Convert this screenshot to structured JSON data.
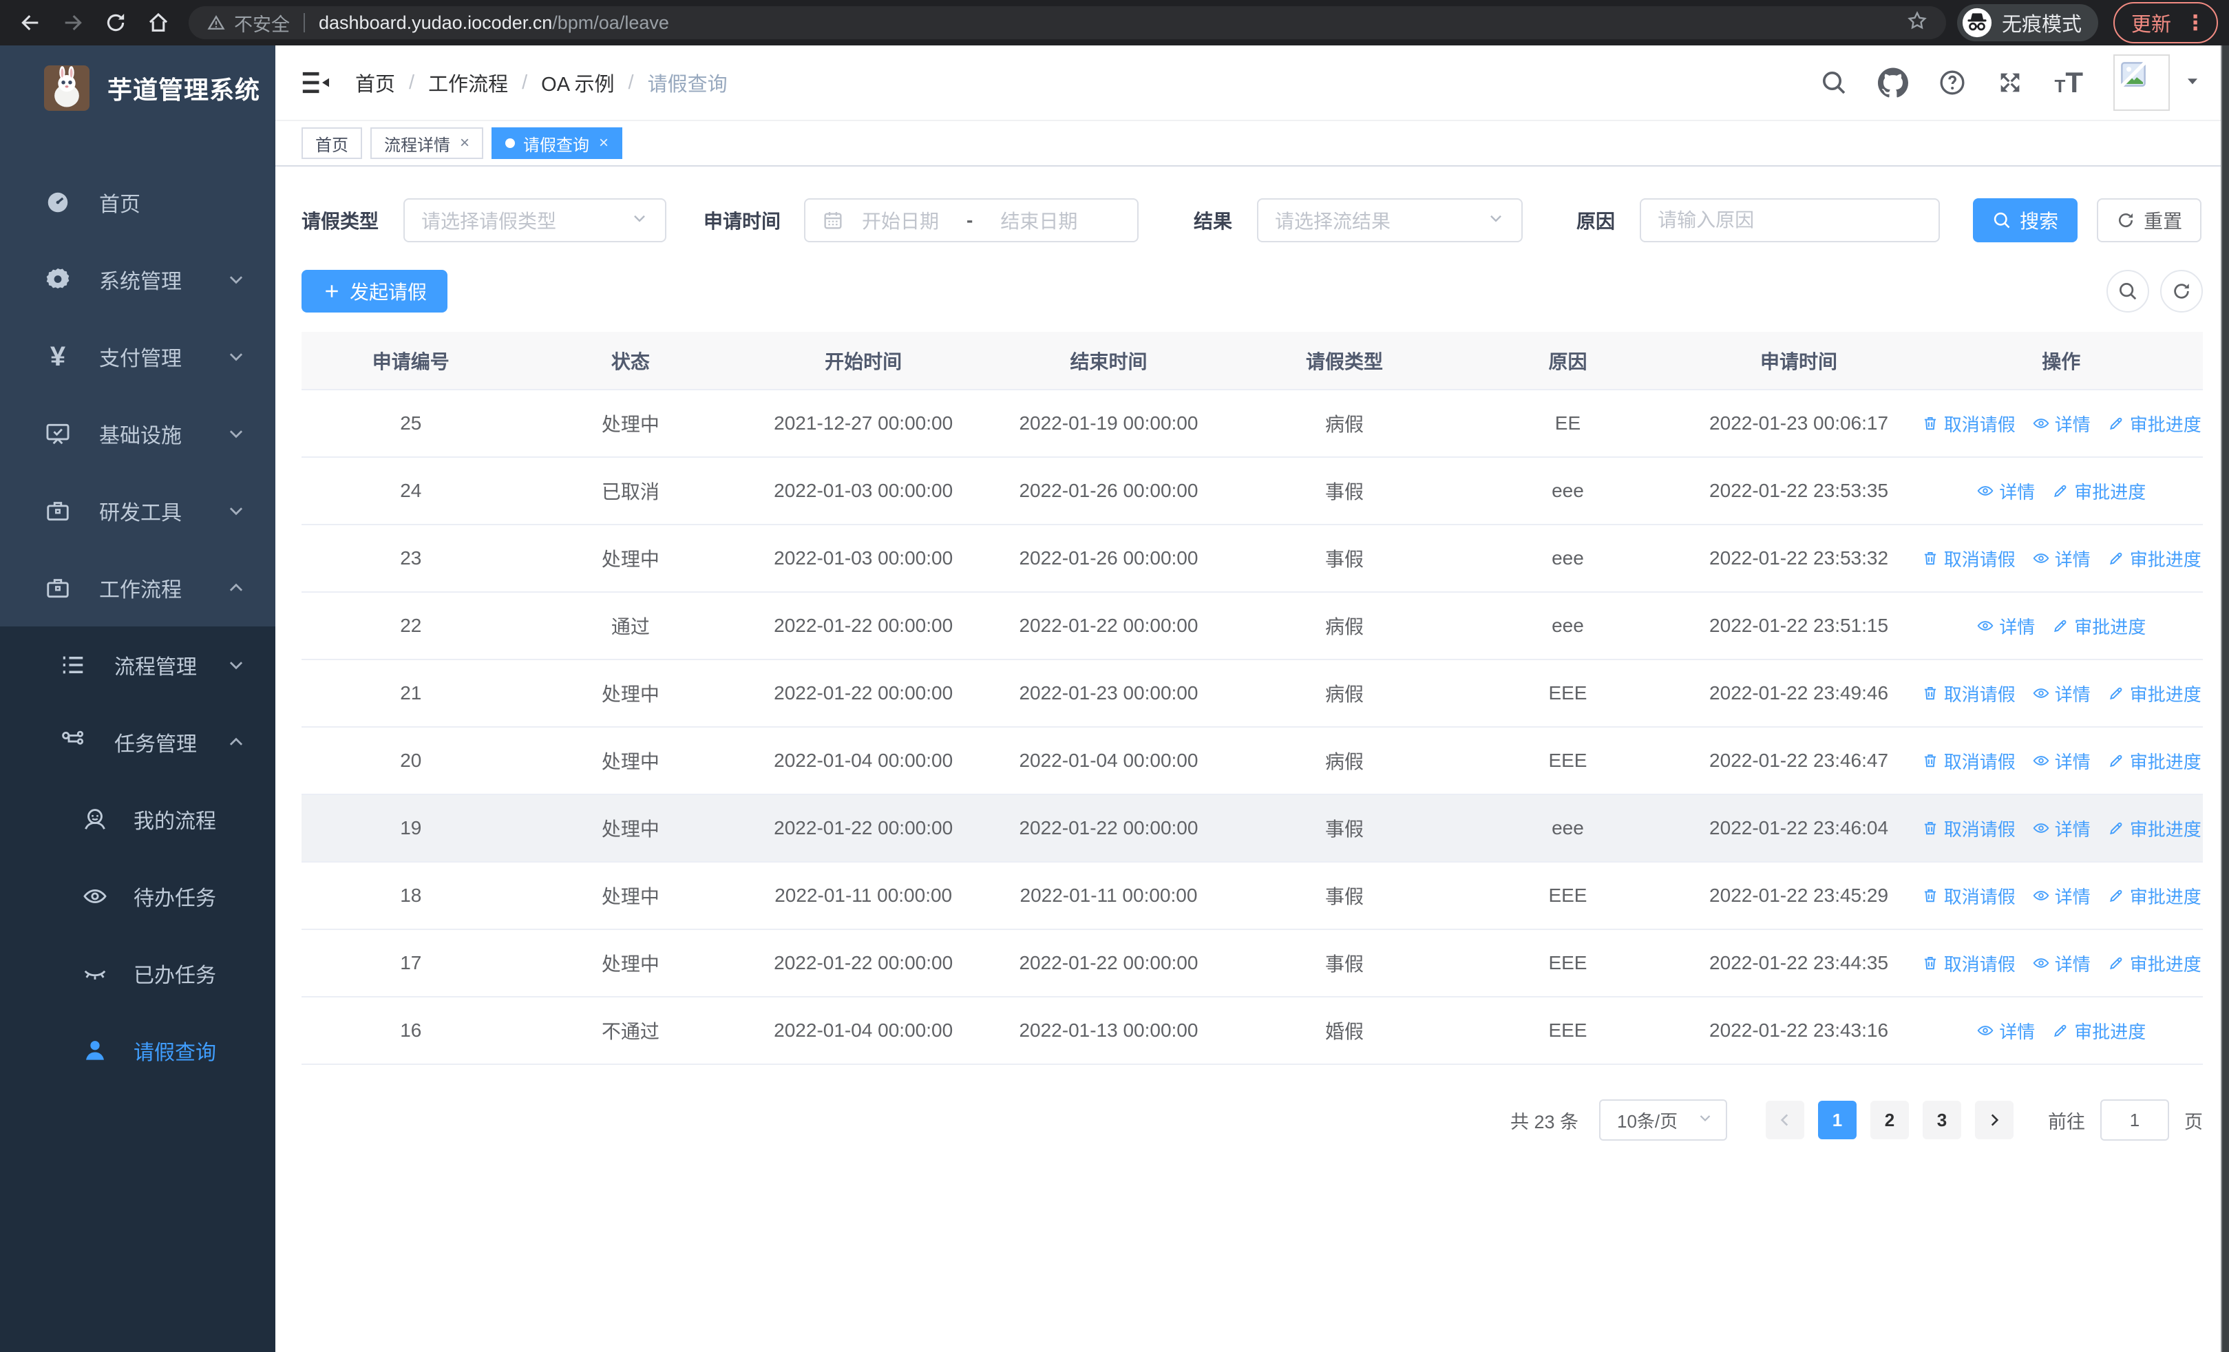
{
  "browser": {
    "security_label": "不安全",
    "url_host": "dashboard.yudao.iocoder.cn",
    "url_path": "/bpm/oa/leave",
    "incognito_label": "无痕模式",
    "update_label": "更新"
  },
  "sidebar": {
    "title": "芋道管理系统",
    "home": "首页",
    "system": "系统管理",
    "payment": "支付管理",
    "infra": "基础设施",
    "devtools": "研发工具",
    "workflow": "工作流程",
    "process_mgmt": "流程管理",
    "task_mgmt": "任务管理",
    "my_process": "我的流程",
    "todo_tasks": "待办任务",
    "done_tasks": "已办任务",
    "leave_query": "请假查询"
  },
  "breadcrumb": [
    "首页",
    "工作流程",
    "OA 示例",
    "请假查询"
  ],
  "tabs": [
    {
      "label": "首页",
      "closable": false,
      "active": false
    },
    {
      "label": "流程详情",
      "closable": true,
      "active": false
    },
    {
      "label": "请假查询",
      "closable": true,
      "active": true
    }
  ],
  "filters": {
    "leave_type_label": "请假类型",
    "leave_type_placeholder": "请选择请假类型",
    "apply_time_label": "申请时间",
    "date_start_placeholder": "开始日期",
    "date_separator": "-",
    "date_end_placeholder": "结束日期",
    "result_label": "结果",
    "result_placeholder": "请选择流结果",
    "reason_label": "原因",
    "reason_placeholder": "请输入原因",
    "search_label": "搜索",
    "reset_label": "重置"
  },
  "toolbar": {
    "create_label": "发起请假"
  },
  "table": {
    "columns": [
      "申请编号",
      "状态",
      "开始时间",
      "结束时间",
      "请假类型",
      "原因",
      "申请时间",
      "操作"
    ],
    "actions": {
      "cancel": "取消请假",
      "detail": "详情",
      "progress": "审批进度"
    },
    "rows": [
      {
        "id": "25",
        "status": "处理中",
        "start": "2021-12-27 00:00:00",
        "end": "2022-01-19 00:00:00",
        "type": "病假",
        "reason": "EE",
        "apply": "2022-01-23 00:06:17",
        "cancellable": true,
        "highlight": false
      },
      {
        "id": "24",
        "status": "已取消",
        "start": "2022-01-03 00:00:00",
        "end": "2022-01-26 00:00:00",
        "type": "事假",
        "reason": "eee",
        "apply": "2022-01-22 23:53:35",
        "cancellable": false,
        "highlight": false
      },
      {
        "id": "23",
        "status": "处理中",
        "start": "2022-01-03 00:00:00",
        "end": "2022-01-26 00:00:00",
        "type": "事假",
        "reason": "eee",
        "apply": "2022-01-22 23:53:32",
        "cancellable": true,
        "highlight": false
      },
      {
        "id": "22",
        "status": "通过",
        "start": "2022-01-22 00:00:00",
        "end": "2022-01-22 00:00:00",
        "type": "病假",
        "reason": "eee",
        "apply": "2022-01-22 23:51:15",
        "cancellable": false,
        "highlight": false
      },
      {
        "id": "21",
        "status": "处理中",
        "start": "2022-01-22 00:00:00",
        "end": "2022-01-23 00:00:00",
        "type": "病假",
        "reason": "EEE",
        "apply": "2022-01-22 23:49:46",
        "cancellable": true,
        "highlight": false
      },
      {
        "id": "20",
        "status": "处理中",
        "start": "2022-01-04 00:00:00",
        "end": "2022-01-04 00:00:00",
        "type": "病假",
        "reason": "EEE",
        "apply": "2022-01-22 23:46:47",
        "cancellable": true,
        "highlight": false
      },
      {
        "id": "19",
        "status": "处理中",
        "start": "2022-01-22 00:00:00",
        "end": "2022-01-22 00:00:00",
        "type": "事假",
        "reason": "eee",
        "apply": "2022-01-22 23:46:04",
        "cancellable": true,
        "highlight": true
      },
      {
        "id": "18",
        "status": "处理中",
        "start": "2022-01-11 00:00:00",
        "end": "2022-01-11 00:00:00",
        "type": "事假",
        "reason": "EEE",
        "apply": "2022-01-22 23:45:29",
        "cancellable": true,
        "highlight": false
      },
      {
        "id": "17",
        "status": "处理中",
        "start": "2022-01-22 00:00:00",
        "end": "2022-01-22 00:00:00",
        "type": "事假",
        "reason": "EEE",
        "apply": "2022-01-22 23:44:35",
        "cancellable": true,
        "highlight": false
      },
      {
        "id": "16",
        "status": "不通过",
        "start": "2022-01-04 00:00:00",
        "end": "2022-01-13 00:00:00",
        "type": "婚假",
        "reason": "EEE",
        "apply": "2022-01-22 23:43:16",
        "cancellable": false,
        "highlight": false
      }
    ]
  },
  "pagination": {
    "total_label": "共 23 条",
    "page_size_label": "10条/页",
    "pages": [
      "1",
      "2",
      "3"
    ],
    "active_page": "1",
    "goto_label": "前往",
    "goto_value": "1",
    "page_unit_label": "页"
  },
  "colors": {
    "primary": "#409eff",
    "sidebar_bg": "#304156",
    "submenu_bg": "#1f2d3d",
    "link_blue": "#459ffc",
    "update_accent": "#f28b82"
  }
}
